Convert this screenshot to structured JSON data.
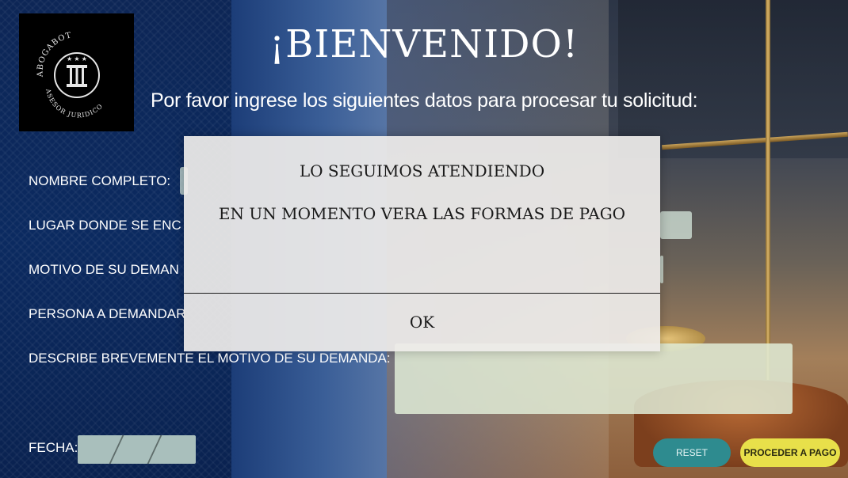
{
  "header": {
    "title": "¡BIENVENIDO!",
    "subtitle": "Por favor ingrese los siguientes datos para procesar tu solicitud:"
  },
  "logo": {
    "top_text": "ABOGABOT",
    "bottom_text": "ASESOR JURIDICO"
  },
  "form": {
    "nombre_label": "NOMBRE COMPLETO:",
    "lugar_label": "LUGAR DONDE SE ENC",
    "motivo_label": "MOTIVO DE SU DEMAN",
    "persona_label": "PERSONA A DEMANDAR",
    "describe_label": "DESCRIBE BREVEMENTE EL MOTIVO DE SU DEMANDA:",
    "fecha_label": "FECHA:"
  },
  "buttons": {
    "reset": "RESET",
    "proceed": "PROCEDER A PAGO"
  },
  "modal": {
    "line1": "LO SEGUIMOS ATENDIENDO",
    "line2": "EN UN MOMENTO VERA LAS FORMAS DE PAGO",
    "ok": "OK"
  },
  "colors": {
    "reset_button": "#2e8b8f",
    "proceed_button": "#e8e04a",
    "field_bg": "#d7e8de"
  }
}
